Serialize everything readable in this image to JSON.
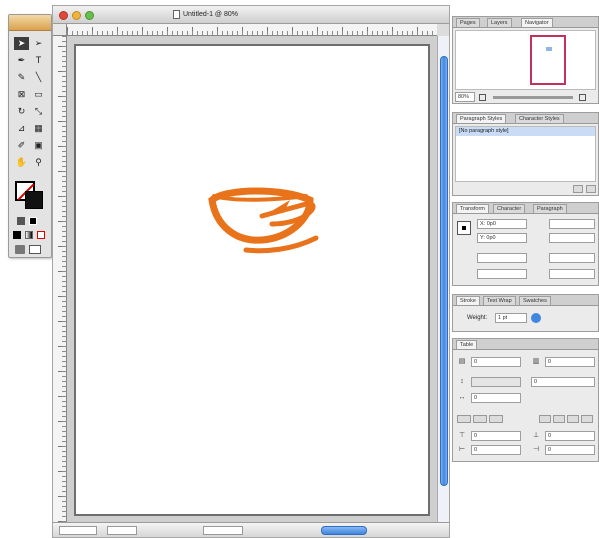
{
  "document": {
    "title": "Untitled-1 @ 80%"
  },
  "tools": [
    {
      "name": "selection-tool",
      "glyph": "➤"
    },
    {
      "name": "direct-selection-tool",
      "glyph": "➢"
    },
    {
      "name": "pen-tool",
      "glyph": "✒"
    },
    {
      "name": "type-tool",
      "glyph": "T"
    },
    {
      "name": "pencil-tool",
      "glyph": "✎"
    },
    {
      "name": "line-tool",
      "glyph": "╲"
    },
    {
      "name": "rectangle-frame-tool",
      "glyph": "⊠"
    },
    {
      "name": "rectangle-tool",
      "glyph": "▭"
    },
    {
      "name": "rotate-tool",
      "glyph": "↻"
    },
    {
      "name": "scale-tool",
      "glyph": "⤡"
    },
    {
      "name": "shear-tool",
      "glyph": "⊿"
    },
    {
      "name": "gradient-tool",
      "glyph": "▦"
    },
    {
      "name": "eyedropper-tool",
      "glyph": "✐"
    },
    {
      "name": "button-tool",
      "glyph": "▣"
    },
    {
      "name": "hand-tool",
      "glyph": "✋"
    },
    {
      "name": "zoom-tool",
      "glyph": "⚲"
    }
  ],
  "panels": {
    "navigator": {
      "tabs": [
        "Pages",
        "Layers",
        "Navigator"
      ],
      "zoom": "80%"
    },
    "paragraph_styles": {
      "tabs": [
        "Paragraph Styles",
        "Character Styles"
      ],
      "items": [
        "[No paragraph style]"
      ]
    },
    "transform": {
      "tabs": [
        "Transform",
        "Character",
        "Paragraph"
      ],
      "x": "X: 0p0",
      "y": "Y: 0p0"
    },
    "stroke": {
      "tabs": [
        "Stroke",
        "Text Wrap",
        "Swatches"
      ],
      "weight_label": "Weight:",
      "weight_value": "1 pt"
    },
    "table": {
      "tabs": [
        "Table"
      ],
      "fields": [
        "0",
        "0",
        "0",
        "0",
        "0",
        "0",
        "0",
        "0"
      ]
    }
  },
  "colors": {
    "cup": "#e8731a",
    "scroll": "#3f86e0",
    "selection": "#c9dbf5"
  }
}
